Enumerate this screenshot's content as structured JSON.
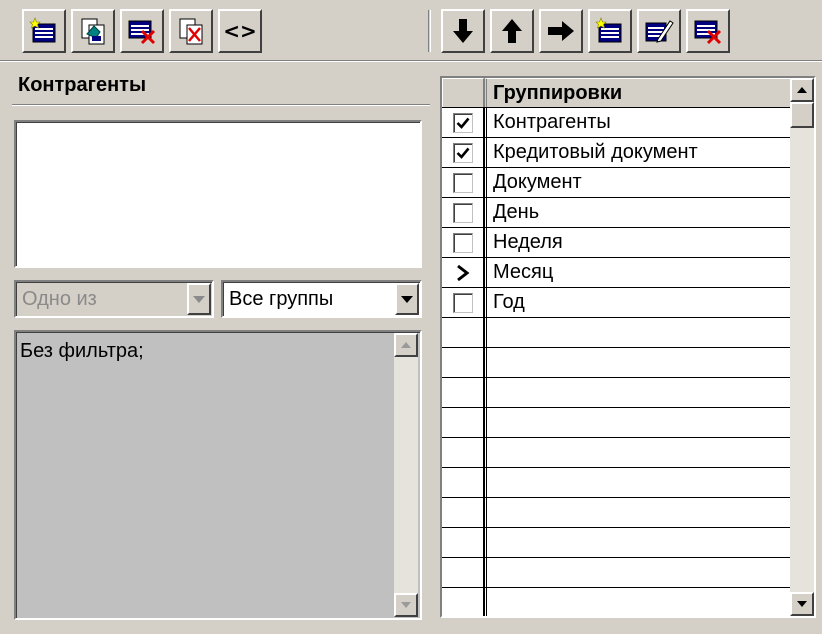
{
  "toolbar_left": [
    {
      "name": "new-filter-icon",
      "label": ""
    },
    {
      "name": "copy-filter-icon",
      "label": ""
    },
    {
      "name": "delete-filter-icon",
      "label": ""
    },
    {
      "name": "clear-filter-icon",
      "label": ""
    },
    {
      "name": "angle-brackets-icon",
      "label": "<>"
    }
  ],
  "toolbar_right": [
    {
      "name": "arrow-down-icon"
    },
    {
      "name": "arrow-up-icon"
    },
    {
      "name": "arrow-right-icon"
    },
    {
      "name": "new-grouping-icon"
    },
    {
      "name": "edit-grouping-icon"
    },
    {
      "name": "delete-grouping-icon"
    }
  ],
  "left_panel": {
    "title": "Контрагенты",
    "condition_combo": {
      "value": "Одно из"
    },
    "group_combo": {
      "value": "Все группы"
    },
    "filter_text": "Без фильтра;"
  },
  "grid": {
    "header": "Группировки",
    "rows": [
      {
        "label": "Контрагенты",
        "state": "checked"
      },
      {
        "label": "Кредитовый документ",
        "state": "checked"
      },
      {
        "label": "Документ",
        "state": "unchecked"
      },
      {
        "label": "День",
        "state": "unchecked"
      },
      {
        "label": "Неделя",
        "state": "unchecked"
      },
      {
        "label": "Месяц",
        "state": "current"
      },
      {
        "label": "Год",
        "state": "unchecked"
      }
    ],
    "empty_rows": 10
  },
  "colors": {
    "face": "#d4d0c8",
    "shadow": "#808080",
    "highlight": "#ffffff",
    "delete_red": "#e00000"
  }
}
